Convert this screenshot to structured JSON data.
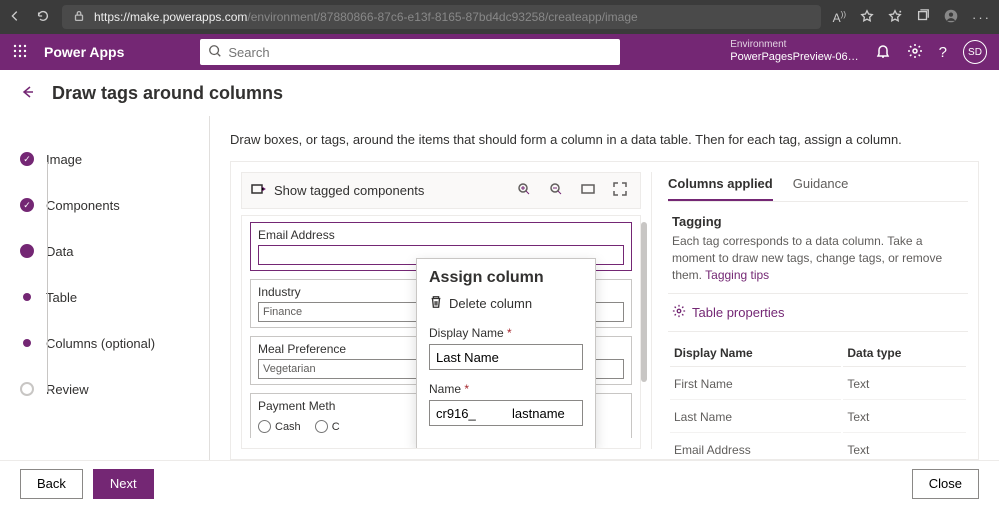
{
  "browser": {
    "url_host": "https://make.powerapps.com",
    "url_path": "/environment/87880866-87c6-e13f-8165-87bd4dc93258/createapp/image"
  },
  "header": {
    "app_name": "Power Apps",
    "search_placeholder": "Search",
    "env_label": "Environment",
    "env_value": "PowerPagesPreview-06…",
    "avatar_initials": "SD"
  },
  "page": {
    "title": "Draw tags around columns",
    "instruction": "Draw boxes, or tags, around the items that should form a column in a data table. Then for each tag, assign a column."
  },
  "steps": [
    {
      "label": "Image",
      "state": "done"
    },
    {
      "label": "Components",
      "state": "done"
    },
    {
      "label": "Data",
      "state": "current"
    },
    {
      "label": "Table",
      "state": "sub"
    },
    {
      "label": "Columns (optional)",
      "state": "sub"
    },
    {
      "label": "Review",
      "state": "pending"
    }
  ],
  "toolbar": {
    "show_tagged": "Show tagged components"
  },
  "preview_fields": {
    "email": {
      "label": "Email Address",
      "value": ""
    },
    "industry": {
      "label": "Industry",
      "value": "Finance"
    },
    "meal": {
      "label": "Meal Preference",
      "value": "Vegetarian"
    },
    "payment": {
      "label": "Payment Meth",
      "opt1": "Cash",
      "opt2": "C"
    }
  },
  "popup": {
    "title": "Assign column",
    "delete": "Delete column",
    "display_name_label": "Display Name",
    "display_name_value": "Last Name",
    "name_label": "Name",
    "name_prefix": "cr916_",
    "name_value": "lastname"
  },
  "right": {
    "tab_columns": "Columns applied",
    "tab_guidance": "Guidance",
    "tagging_title": "Tagging",
    "tagging_body": "Each tag corresponds to a data column. Take a moment to draw new tags, change tags, or remove them. ",
    "tagging_link": "Tagging tips",
    "table_props": "Table properties",
    "th_display": "Display Name",
    "th_type": "Data type",
    "rows": [
      {
        "name": "First Name",
        "type": "Text"
      },
      {
        "name": "Last Name",
        "type": "Text"
      },
      {
        "name": "Email Address",
        "type": "Text"
      }
    ]
  },
  "footer": {
    "back": "Back",
    "next": "Next",
    "close": "Close"
  }
}
